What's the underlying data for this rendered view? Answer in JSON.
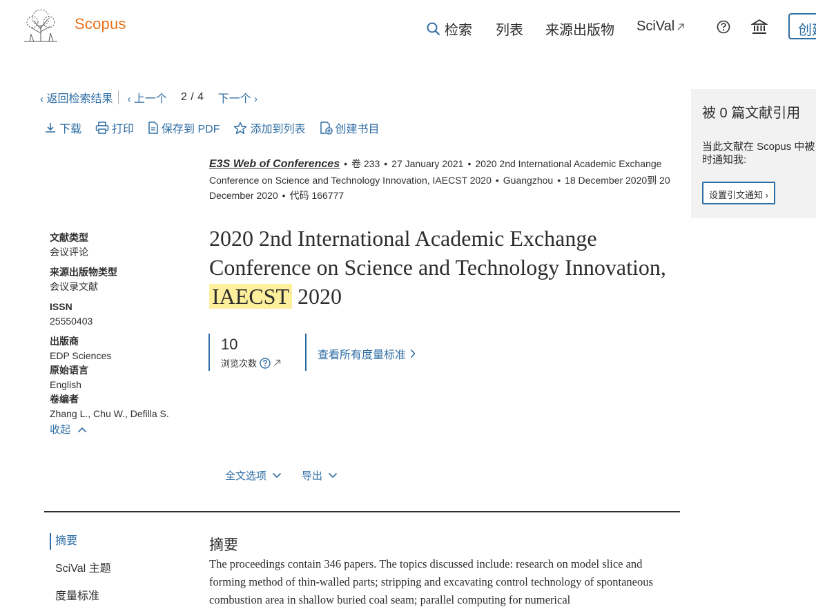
{
  "header": {
    "brand": "Scopus",
    "nav": {
      "search": "检索",
      "lists": "列表",
      "sources": "来源出版物",
      "scival": "SciVal"
    },
    "create_label": "创建"
  },
  "breadcrumb": {
    "back": "返回检索结果",
    "prev": "上一个",
    "pager": "2 / 4",
    "next": "下一个"
  },
  "toolbar": {
    "download": "下载",
    "print": "打印",
    "save_pdf": "保存到 PDF",
    "add_list": "添加到列表",
    "create_bib": "创建书目"
  },
  "source": {
    "journal": "E3S Web of Conferences",
    "volume": "卷 233",
    "date": "27 January 2021",
    "conference": "2020 2nd International Academic Exchange Conference on Science and Technology Innovation, IAECST 2020",
    "location": "Guangzhou",
    "conf_dates": "18 December 2020到 20 December 2020",
    "code": "代码 166777"
  },
  "title": {
    "before": "2020 2nd International Academic Exchange Conference on Science and Technology Innovation,",
    "highlight": "IAECST",
    "after": "2020"
  },
  "details": {
    "doc_type_label": "文献类型",
    "doc_type": "会议评论",
    "source_type_label": "来源出版物类型",
    "source_type": "会议录文献",
    "issn_label": "ISSN",
    "issn": "25550403",
    "publisher_label": "出版商",
    "publisher": "EDP Sciences",
    "language_label": "原始语言",
    "language": "English",
    "editors_label": "卷编者",
    "editors": "Zhang L., Chu W., Defilla S.",
    "collapse": "收起"
  },
  "metrics": {
    "views": "10",
    "views_label": "浏览次数",
    "all_metrics": "查看所有度量标准"
  },
  "options": {
    "fulltext": "全文选项",
    "export": "导出"
  },
  "section_nav": [
    "摘要",
    "SciVal 主题",
    "度量标准"
  ],
  "abstract": {
    "heading": "摘要",
    "text": "The proceedings contain 346 papers. The topics discussed include: research on model slice and forming method of thin-walled parts; stripping and excavating control technology of spontaneous combustion area in shallow buried coal seam; parallel computing for numerical"
  },
  "cited_by": {
    "title": "被 0 篇文献引用",
    "desc": "当此文献在 Scopus 中被引用时通知我:",
    "alert_button": "设置引文通知"
  },
  "colors": {
    "brand": "#e9711c",
    "link": "#2e6da4",
    "highlight": "#fdef9c",
    "panel": "#f2f2f2"
  }
}
